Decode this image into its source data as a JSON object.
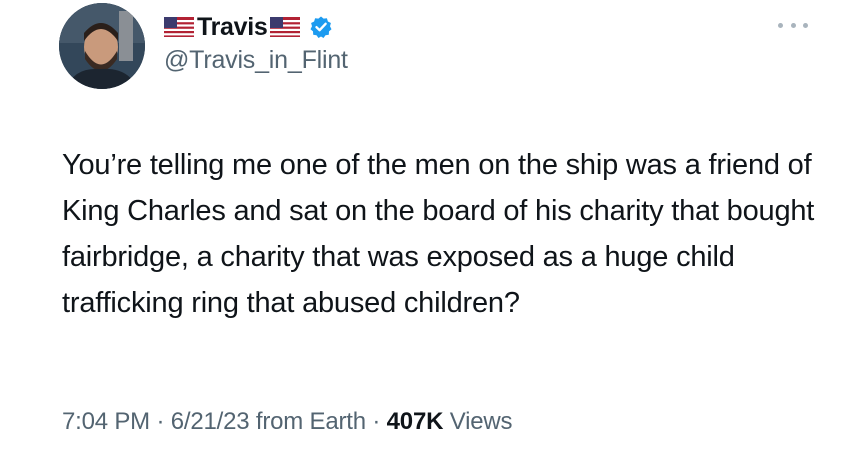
{
  "author": {
    "display_name": "Travis",
    "handle": "@Travis_in_Flint",
    "verified": true,
    "flag_icon": "us-flag-icon",
    "verified_icon": "verified-badge-icon"
  },
  "tweet": {
    "text": "You’re telling me one of the men on the ship was a friend of King Charles and sat on the board of his charity that bought fairbridge, a charity that was exposed as a huge child trafficking ring that abused children?",
    "time": "7:04 PM",
    "separator": "·",
    "date": "6/21/23",
    "source": "from Earth",
    "views_count": "407K",
    "views_label": "Views"
  },
  "colors": {
    "text": "#0f1419",
    "secondary": "#536471",
    "verified": "#1d9bf0"
  },
  "menu": {
    "icon": "more-options-icon"
  }
}
